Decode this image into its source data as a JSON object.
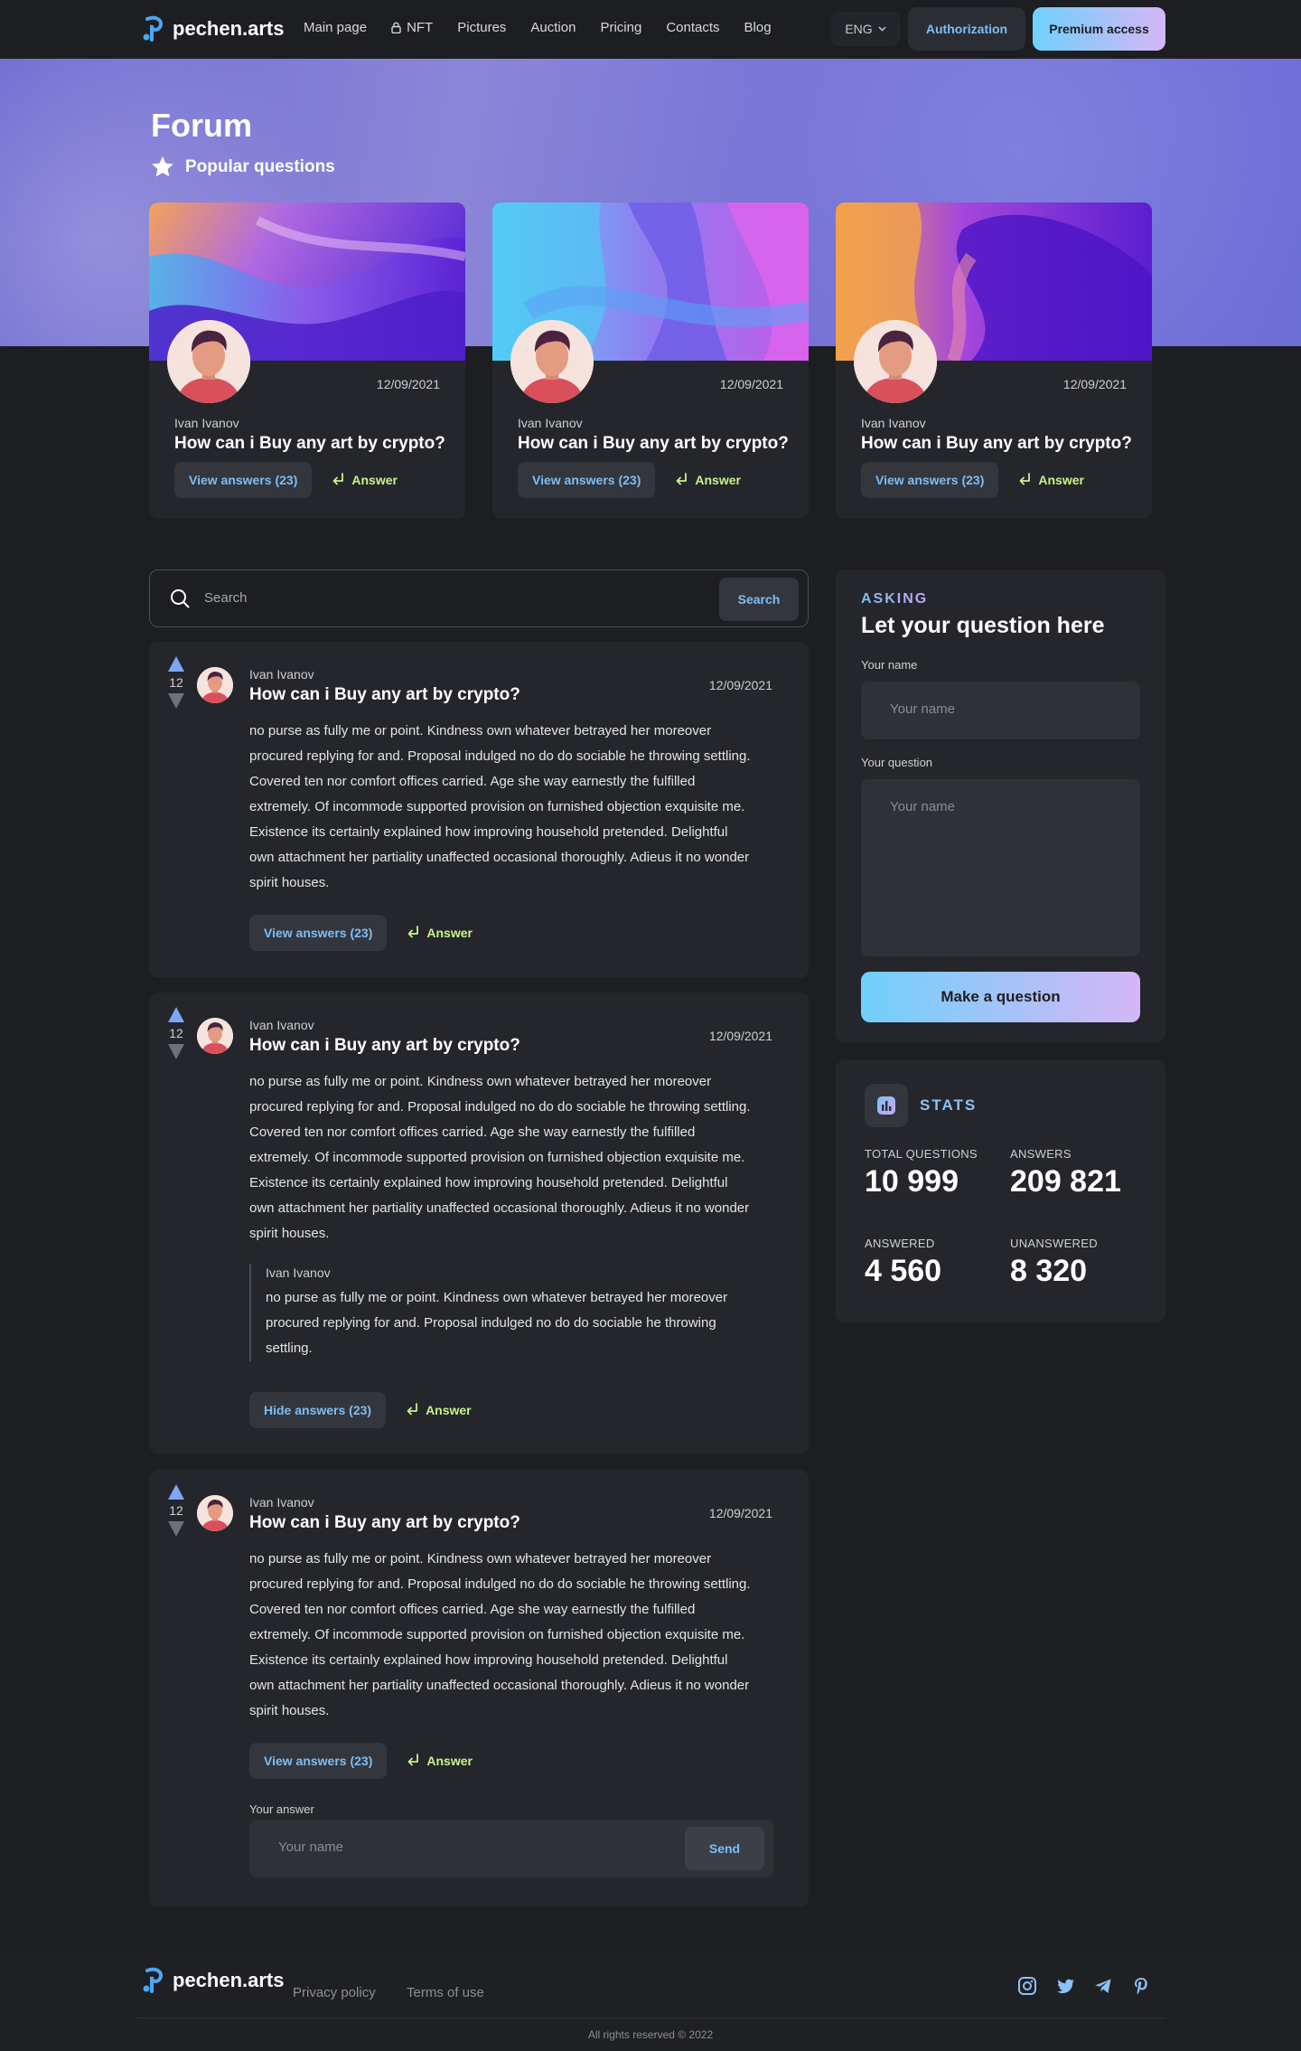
{
  "header": {
    "logo": "pechen.arts",
    "nav": [
      "Main page",
      "NFT",
      "Pictures",
      "Auction",
      "Pricing",
      "Contacts",
      "Blog"
    ],
    "lang": "ENG",
    "auth": "Authorization",
    "premium": "Premium access"
  },
  "hero": {
    "title": "Forum",
    "subtitle": "Popular questions"
  },
  "popular": [
    {
      "date": "12/09/2021",
      "author": "Ivan Ivanov",
      "question": "How can i Buy any art by crypto?",
      "view": "View answers (23)",
      "answer": "Answer"
    },
    {
      "date": "12/09/2021",
      "author": "Ivan Ivanov",
      "question": "How can i Buy any art by crypto?",
      "view": "View answers (23)",
      "answer": "Answer"
    },
    {
      "date": "12/09/2021",
      "author": "Ivan Ivanov",
      "question": "How can i Buy any art by crypto?",
      "view": "View answers (23)",
      "answer": "Answer"
    }
  ],
  "search": {
    "placeholder": "Search",
    "button": "Search"
  },
  "questions": [
    {
      "votes": "12",
      "author": "Ivan Ivanov",
      "title": "How can i Buy any art by crypto?",
      "date": "12/09/2021",
      "body": "no purse as fully me or point. Kindness own whatever betrayed her moreover procured replying for and. Proposal indulged no do do sociable he throwing settling. Covered ten nor comfort offices carried. Age she way earnestly the fulfilled extremely. Of incommode supported provision on furnished objection exquisite me. Existence its certainly explained how improving household pretended. Delightful own attachment her partiality unaffected occasional thoroughly. Adieus it no wonder spirit houses.",
      "toggle": "View answers (23)",
      "answer": "Answer"
    },
    {
      "votes": "12",
      "author": "Ivan Ivanov",
      "title": "How can i Buy any art by crypto?",
      "date": "12/09/2021",
      "body": "no purse as fully me or point. Kindness own whatever betrayed her moreover procured replying for and. Proposal indulged no do do sociable he throwing settling. Covered ten nor comfort offices carried. Age she way earnestly the fulfilled extremely. Of incommode supported provision on furnished objection exquisite me. Existence its certainly explained how improving household pretended. Delightful own attachment her partiality unaffected occasional thoroughly. Adieus it no wonder spirit houses.",
      "reply_author": "Ivan Ivanov",
      "reply_body": "no purse as fully me or point. Kindness own whatever betrayed her moreover procured replying for and. Proposal indulged no do do sociable he throwing settling.",
      "toggle": "Hide answers (23)",
      "answer": "Answer"
    },
    {
      "votes": "12",
      "author": "Ivan Ivanov",
      "title": "How can i Buy any art by crypto?",
      "date": "12/09/2021",
      "body": "no purse as fully me or point. Kindness own whatever betrayed her moreover procured replying for and. Proposal indulged no do do sociable he throwing settling. Covered ten nor comfort offices carried. Age she way earnestly the fulfilled extremely. Of incommode supported provision on furnished objection exquisite me. Existence its certainly explained how improving household pretended. Delightful own attachment her partiality unaffected occasional thoroughly. Adieus it no wonder spirit houses.",
      "toggle": "View answers (23)",
      "answer": "Answer",
      "your_answer_label": "Your answer",
      "your_answer_placeholder": "Your name",
      "send": "Send"
    }
  ],
  "ask": {
    "eyebrow": "ASKING",
    "title": "Let your question here",
    "name_label": "Your name",
    "name_placeholder": "Your name",
    "question_label": "Your question",
    "question_placeholder": "Your name",
    "submit": "Make a question"
  },
  "stats": {
    "title": "STATS",
    "items": [
      {
        "label": "TOTAL QUESTIONS",
        "value": "10 999"
      },
      {
        "label": "ANSWERS",
        "value": "209 821"
      },
      {
        "label": "ANSWERED",
        "value": "4 560"
      },
      {
        "label": "UNANSWERED",
        "value": "8 320"
      }
    ]
  },
  "footer": {
    "logo": "pechen.arts",
    "links": [
      "Privacy policy",
      "Terms of use"
    ],
    "social": [
      "instagram-icon",
      "twitter-icon",
      "telegram-icon",
      "pinterest-icon"
    ],
    "copyright": "All rights reserved © 2022"
  },
  "colors": {
    "accent_blue": "#7fbef5",
    "accent_green": "#c9f28e",
    "bg": "#1d1e21",
    "card": "#24262b"
  }
}
